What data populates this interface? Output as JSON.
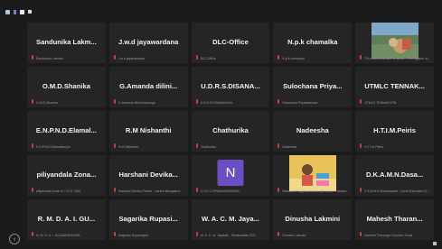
{
  "toolbar": {
    "icons": [
      "status-icon",
      "signal-icon",
      "view-icon",
      "fullscreen-icon"
    ]
  },
  "nav": {
    "prev_symbol": "‹"
  },
  "participants": [
    {
      "name": "Sandunika Lakm...",
      "label": "Sandunika Lakmali"
    },
    {
      "name": "J.w.d jayawardana",
      "label": "J.w.d jayawardana"
    },
    {
      "name": "DLC-Office",
      "label": "DLC-Office"
    },
    {
      "name": "N.p.k chamalka",
      "label": "N.p.k chamalka"
    },
    {
      "name": "",
      "label": "T.H.madhushanka Fernando - Hiru Ngame w...",
      "tile": "photo-dog"
    },
    {
      "name": "O.M.D.Shanika",
      "label": "O.M.D.Shanika"
    },
    {
      "name": "G.Amanda dilini...",
      "label": "G.Amanda dilini kulatunga"
    },
    {
      "name": "U.D.R.S.DISANA...",
      "label": "U.D.R.S.DISANAYAKA"
    },
    {
      "name": "Sulochana Priya...",
      "label": "Sulochana Priyadarshani"
    },
    {
      "name": "UTMLC TENNAK...",
      "label": "UTMLC TENNAKOON"
    },
    {
      "name": "E.N.P.N.D.Elamal...",
      "label": "E.N.P.N.D.Elamaldeniya"
    },
    {
      "name": "R.M Nishanthi",
      "label": "R.M Nishanthi"
    },
    {
      "name": "Chathurika",
      "label": "Chathurika"
    },
    {
      "name": "Nadeesha",
      "label": "Nadeesha"
    },
    {
      "name": "H.T.I.M.Peiris",
      "label": "H.T.I.M.Peiris"
    },
    {
      "name": "piliyandala Zona...",
      "label": "piliyandala Zonal & C.S.O / 554"
    },
    {
      "name": "Harshani Devika...",
      "label": "Harshani Devika Perera - Jaela Kaluragama"
    },
    {
      "name": "",
      "label": "C.V.D.C.PRABHASHWARA",
      "tile": "avatar",
      "initial": "N",
      "color": "#6a4fc4"
    },
    {
      "name": "",
      "label": "Bhanuka Poljayawardhana (Bhanu) / Suthana",
      "tile": "photo-kids"
    },
    {
      "name": "D.K.A.M.N.Dasa...",
      "label": "D.K.A.M.N.Dasanayaka - Zonal Education O..."
    },
    {
      "name": "R. M. D. A. I. GU...",
      "label": "R. M. D. A. I. GUNAWARDANA"
    },
    {
      "name": "Sagarika Rupasi...",
      "label": "Sagarika Rupasinghe"
    },
    {
      "name": "W. A. C. M. Jaya...",
      "label": "W. A. C. M. Jayalath - Ethalawatta ZEO"
    },
    {
      "name": "Dinusha Lakmini",
      "label": "Dinusha Lakmini"
    },
    {
      "name": "Mahesh Tharan...",
      "label": "Mahesh Tharanga Colombo Zonal"
    }
  ]
}
